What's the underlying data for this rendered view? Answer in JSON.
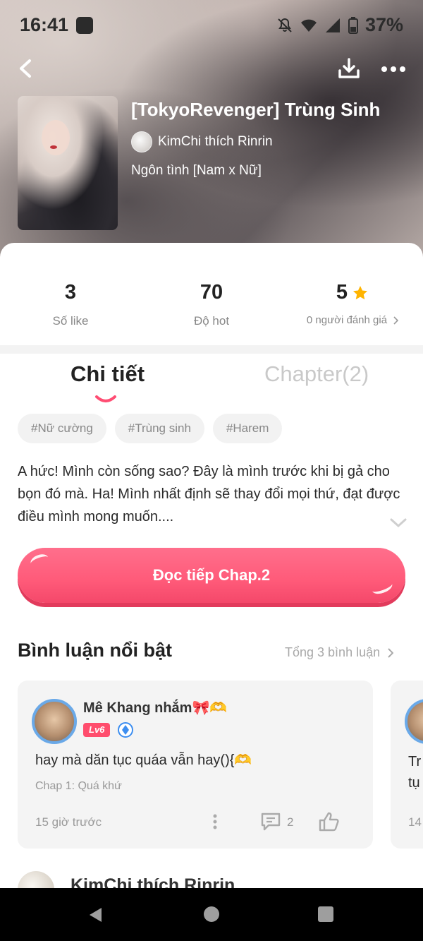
{
  "status_bar": {
    "time": "16:41",
    "battery": "37%"
  },
  "header": {
    "title": "[TokyoRevenger] Trùng Sinh",
    "author": "KimChi thích Rinrin",
    "genre": "Ngôn tình [Nam x Nữ]"
  },
  "stats": [
    {
      "value": "3",
      "label": "Số like"
    },
    {
      "value": "70",
      "label": "Độ hot"
    },
    {
      "value": "5",
      "label": "0 người đánh giá"
    }
  ],
  "tabs": {
    "active": "Chi tiết",
    "inactive": "Chapter(2)"
  },
  "tags": [
    "#Nữ cường",
    "#Trùng sinh",
    "#Harem"
  ],
  "description": "A hức! Mình còn sống sao? Đây là mình trước khi bị gả cho bọn đó mà. Ha! Mình nhất định sẽ thay đổi mọi thứ, đạt được điều mình mong muốn....",
  "read_button": "Đọc tiếp Chap.2",
  "comments_section": {
    "title": "Bình luận nổi bật",
    "total": "Tổng 3 bình luận",
    "cards": [
      {
        "name": "Mê Khang nhắm🎀🫶",
        "level": "Lv6",
        "text": "hay mà dăn tục quáa vẫn hay(){🫶",
        "chapter": "Chap 1: Quá khứ",
        "time": "15 giờ trước",
        "replies": "2"
      },
      {
        "text": "Tr\ntụ",
        "time": "14"
      }
    ],
    "next_author": "KimChi thích Rinrin"
  },
  "colors": {
    "accent": "#ff5a79",
    "star": "#ffb400",
    "muted": "#999999"
  }
}
